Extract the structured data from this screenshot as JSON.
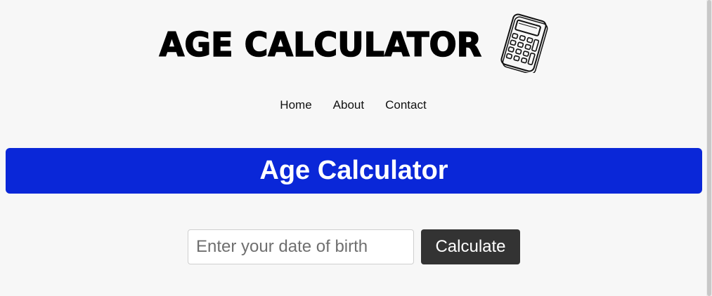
{
  "header": {
    "logo_text": "AGE CALCULATOR",
    "logo_icon": "calculator-icon"
  },
  "nav": {
    "items": [
      {
        "label": "Home"
      },
      {
        "label": "About"
      },
      {
        "label": "Contact"
      }
    ]
  },
  "banner": {
    "title": "Age Calculator",
    "color": "#0a27d8"
  },
  "form": {
    "dob_placeholder": "Enter your date of birth",
    "dob_value": "",
    "calculate_label": "Calculate",
    "button_color": "#333333"
  }
}
